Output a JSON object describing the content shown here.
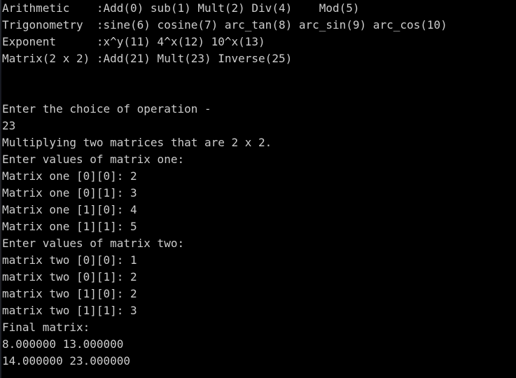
{
  "window": {
    "type": "terminal-console",
    "background_color": "#000000",
    "text_color": "#cccccc",
    "font_size_px": 16,
    "line_height_px": 24,
    "columns": 76,
    "rows": 22
  },
  "menu": {
    "title_lines": [
      "Arithmetic    :Add(0) sub(1) Mult(2) Div(4)    Mod(5)",
      "Trigonometry  :sine(6) cosine(7) arc_tan(8) arc_sin(9) arc_cos(10)",
      "Exponent      :x^y(11) 4^x(12) 10^x(13)",
      "Matrix(2 x 2) :Add(21) Mult(23) Inverse(25)"
    ],
    "categories": [
      {
        "label": "Arithmetic",
        "options": [
          {
            "name": "Add",
            "code": "0"
          },
          {
            "name": "sub",
            "code": "1"
          },
          {
            "name": "Mult",
            "code": "2"
          },
          {
            "name": "Div",
            "code": "4"
          },
          {
            "name": "Mod",
            "code": "5"
          }
        ]
      },
      {
        "label": "Trigonometry",
        "options": [
          {
            "name": "sine",
            "code": "6"
          },
          {
            "name": "cosine",
            "code": "7"
          },
          {
            "name": "arc_tan",
            "code": "8"
          },
          {
            "name": "arc_sin",
            "code": "9"
          },
          {
            "name": "arc_cos",
            "code": "10"
          }
        ]
      },
      {
        "label": "Exponent",
        "options": [
          {
            "name": "x^y",
            "code": "11"
          },
          {
            "name": "4^x",
            "code": "12"
          },
          {
            "name": "10^x",
            "code": "13"
          }
        ]
      },
      {
        "label": "Matrix(2 x 2)",
        "options": [
          {
            "name": "Add",
            "code": "21"
          },
          {
            "name": "Mult",
            "code": "23"
          },
          {
            "name": "Inverse",
            "code": "25"
          }
        ]
      }
    ]
  },
  "session": {
    "prompt": "Enter the choice of operation -",
    "choice_entered": "23",
    "operation_message": "Multiplying two matrices that are 2 x 2.",
    "matrix_one_header": "Enter values of matrix one:",
    "matrix_one_entries": [
      "Matrix one [0][0]: 2",
      "Matrix one [0][1]: 3",
      "Matrix one [1][0]: 4",
      "Matrix one [1][1]: 5"
    ],
    "matrix_two_header": "Enter values of matrix two:",
    "matrix_two_entries": [
      "matrix two [0][0]: 1",
      "matrix two [0][1]: 2",
      "matrix two [1][0]: 2",
      "matrix two [1][1]: 3"
    ],
    "result_header": "Final matrix:",
    "result_rows": [
      "8.000000 13.000000",
      "14.000000 23.000000"
    ]
  },
  "matrices": {
    "matrix_one": [
      [
        2,
        3
      ],
      [
        4,
        5
      ]
    ],
    "matrix_two": [
      [
        1,
        2
      ],
      [
        2,
        3
      ]
    ],
    "result": [
      [
        8.0,
        13.0
      ],
      [
        14.0,
        23.0
      ]
    ]
  }
}
